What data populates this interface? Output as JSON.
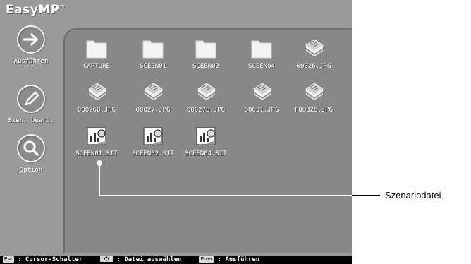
{
  "app": {
    "title": "EasyMP",
    "trademark": "™"
  },
  "sidebar": {
    "buttons": [
      {
        "label": "Ausführen",
        "icon": "arrow-right-icon"
      },
      {
        "label": "Szen. bearb.",
        "icon": "pencil-icon"
      },
      {
        "label": "Option",
        "icon": "magnifier-icon"
      }
    ]
  },
  "files": {
    "row1": [
      "CAPTURE",
      "SCEEN01",
      "SCEEN02",
      "SCEEN04",
      "00026.JPG"
    ],
    "row2": [
      "00026B.JPG",
      "00027.JPG",
      "00027B.JPG",
      "00031.JPG",
      "FUU328.JPG"
    ],
    "row3": [
      "SCEEN01.SIT",
      "SCEEN02.SIT",
      "SCEEN04.SIT"
    ]
  },
  "status_bar": {
    "esc_key": "Esc",
    "esc_text": ": Cursor-Schalter",
    "arrows_text": ": Datei auswählen",
    "enter_key": "Enter",
    "enter_text": ": Ausführen"
  },
  "annotation": {
    "label": "Szenariodatei"
  },
  "colors": {
    "screen_bg": "#9a9a9a",
    "panel_bg": "#888888",
    "status_bg": "#000000",
    "text": "#ffffff"
  }
}
